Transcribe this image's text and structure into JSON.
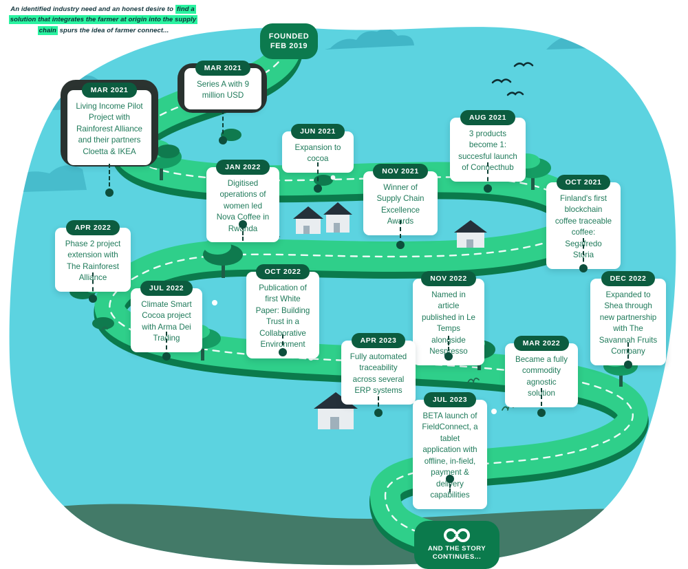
{
  "intro": {
    "lead": "An identified industry need and an honest desire to ",
    "highlight": "find a solution that integrates the farmer at origin into the supply chain",
    "tail": " spurs the idea of farmer connect..."
  },
  "founded": {
    "line1": "FOUNDED",
    "line2": "FEB 2019"
  },
  "story_badge": {
    "logo": "infinity-logo-icon",
    "line1": "AND THE STORY",
    "line2": "CONTINUES..."
  },
  "colors": {
    "blob": "#5cd3e0",
    "road_top": "#2fcf8a",
    "road_side": "#0f9d63",
    "road_dark": "#0b7a4c",
    "chip_green": "#0c5c3f",
    "card_text": "#1f7a5a",
    "highlight_green": "#2af2a0",
    "badge_green": "#0b7a4c"
  },
  "milestones": [
    {
      "id": "mar-2021-living-income",
      "date": "MAR 2021",
      "text": "Living Income Pilot Project with Rainforest Alliance and their partners Cloetta & IKEA"
    },
    {
      "id": "mar-2021-series-a",
      "date": "MAR 2021",
      "text": "Series A with 9 million USD"
    },
    {
      "id": "jun-2021-cocoa",
      "date": "JUN 2021",
      "text": "Expansion to cocoa"
    },
    {
      "id": "aug-2021-connecthub",
      "date": "AUG 2021",
      "text": "3 products become 1: succesful launch of Connecthub"
    },
    {
      "id": "oct-2021-segafredo",
      "date": "OCT 2021",
      "text": "Finland's first blockchain coffee traceable coffee: Segafredo Storia"
    },
    {
      "id": "nov-2021-awards",
      "date": "NOV 2021",
      "text": "Winner of Supply Chain Excellence Awards"
    },
    {
      "id": "jan-2022-nova-coffee",
      "date": "JAN 2022",
      "text": "Digitised operations of women led Nova Coffee in Rwanda"
    },
    {
      "id": "apr-2022-phase-2",
      "date": "APR 2022",
      "text": "Phase 2 project extension with The Rainforest Alliance"
    },
    {
      "id": "jul-2022-climate-smart",
      "date": "JUL 2022",
      "text": "Climate Smart Cocoa project with Arma Dei Trading"
    },
    {
      "id": "oct-2022-white-paper",
      "date": "OCT 2022",
      "text": "Publication of first White Paper: Building Trust in a Collaborative Environment"
    },
    {
      "id": "nov-2022-le-temps",
      "date": "NOV 2022",
      "text": "Named in article published in Le Temps alongside Nespresso"
    },
    {
      "id": "dec-2022-shea",
      "date": "DEC 2022",
      "text": "Expanded to Shea through new partnership with The Savannah Fruits Company"
    },
    {
      "id": "mar-2022-commodity-agnostic",
      "date": "MAR 2022",
      "text": "Became a fully commodity agnostic solution"
    },
    {
      "id": "apr-2023-erp",
      "date": "APR 2023",
      "text": "Fully automated traceability across several ERP systems"
    },
    {
      "id": "jul-2023-fieldconnect",
      "date": "JUL 2023",
      "text": "BETA launch of FieldConnect, a tablet application with offline, in-field, payment & delivery capabilities"
    }
  ]
}
